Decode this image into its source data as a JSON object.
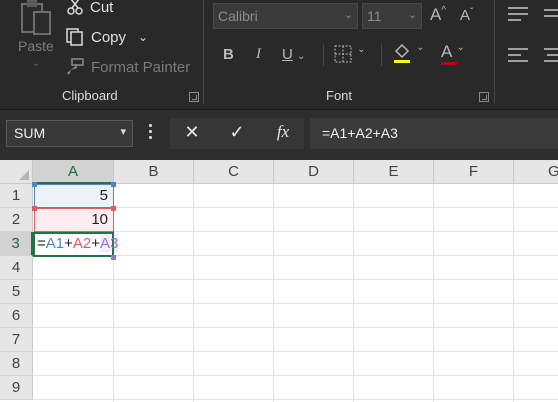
{
  "ribbon": {
    "clipboard": {
      "paste_label": "Paste",
      "cut_label": "Cut",
      "copy_label": "Copy",
      "format_painter_label": "Format Painter",
      "group_label": "Clipboard",
      "icons": [
        "paste-icon",
        "scissors-icon",
        "copy-icon",
        "paintbrush-icon"
      ]
    },
    "font": {
      "font_name": "Calibri",
      "font_size": "11",
      "grow_font_glyph": "A",
      "shrink_font_glyph": "A",
      "bold_glyph": "B",
      "italic_glyph": "I",
      "underline_glyph": "U",
      "font_color_glyph": "A",
      "group_label": "Font",
      "font_color_swatch": "#c00000",
      "fill_color_swatch": "#ffff00"
    }
  },
  "formula_bar": {
    "name_box": "SUM",
    "cancel_glyph": "✕",
    "enter_glyph": "✓",
    "fx_glyph": "fx",
    "formula": "=A1+A2+A3"
  },
  "sheet": {
    "columns": [
      "A",
      "B",
      "C",
      "D",
      "E",
      "F",
      "G"
    ],
    "rows": [
      "1",
      "2",
      "3",
      "4",
      "5",
      "6",
      "7",
      "8",
      "9"
    ],
    "cells": {
      "A1": "5",
      "A2": "10"
    },
    "editing_cell": "A3",
    "editing_tokens": [
      {
        "text": "=",
        "color": "#222222"
      },
      {
        "text": "A1",
        "color": "#4a86c8"
      },
      {
        "text": "+",
        "color": "#222222"
      },
      {
        "text": "A2",
        "color": "#e05d5d"
      },
      {
        "text": "+",
        "color": "#222222"
      },
      {
        "text": "A3",
        "color": "#9b6fd1"
      }
    ],
    "ref_colors": {
      "A1": "#4a86c8",
      "A2": "#e05d5d",
      "A3": "#9b6fd1"
    },
    "selection_color": "#217346"
  }
}
